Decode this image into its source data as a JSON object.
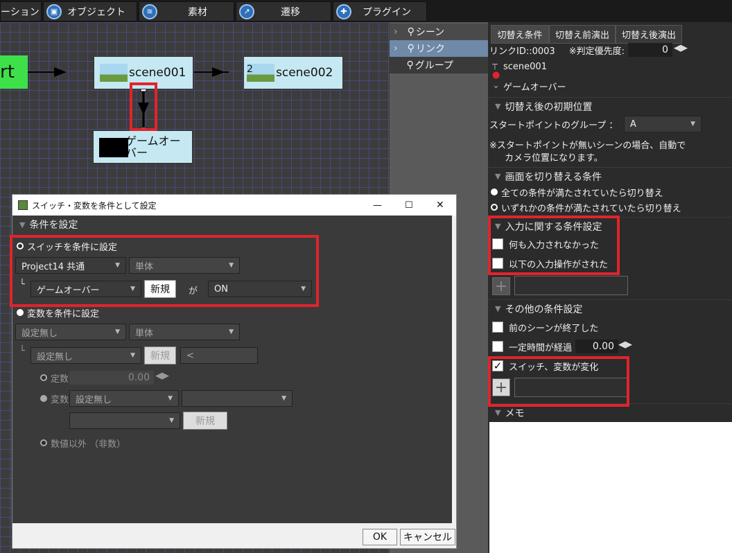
{
  "toolbar": {
    "items": [
      {
        "label": "ーション"
      },
      {
        "label": "オブジェクト"
      },
      {
        "label": "素材"
      },
      {
        "label": "遷移"
      },
      {
        "label": "プラグイン"
      }
    ]
  },
  "canvas": {
    "start_label": "rt",
    "scene1": "scene001",
    "scene2": "scene002",
    "scene3_line1": "ゲームオー",
    "scene3_line2": "バー",
    "scene2_prefix": "2"
  },
  "list": {
    "items": [
      {
        "label": "シーン"
      },
      {
        "label": "リンク"
      },
      {
        "label": "グループ"
      }
    ]
  },
  "props": {
    "tabs": [
      {
        "label": "切替え条件"
      },
      {
        "label": "切替え前演出"
      },
      {
        "label": "切替え後演出"
      }
    ],
    "link_id": "リンクID::0003",
    "priority_label": "※判定優先度:",
    "priority_value": "0",
    "from_scene": "scene001",
    "to_scene": "ゲームオーバー",
    "sec_initial": "切替え後の初期位置",
    "start_group_label": "スタートポイントのグループ ：",
    "start_group_value": "A",
    "note1": "※スタートポイントが無いシーンの場合、自動で",
    "note2": "カメラ位置になります。",
    "sec_conditions": "画面を切り替える条件",
    "radio_all": "全ての条件が満たされていたら切り替え",
    "radio_any": "いずれかの条件が満たされていたら切り替え",
    "sec_input": "入力に関する条件設定",
    "cb_noinput": "何も入力されなかった",
    "cb_input": "以下の入力操作がされた",
    "sec_other": "その他の条件設定",
    "cb_prev": "前のシーンが終了した",
    "cb_time": "一定時間が経過",
    "time_value": "0.00",
    "cb_switch": "スイッチ、変数が変化",
    "check_mark": "✓",
    "sec_memo": "メモ"
  },
  "dialog": {
    "title": "スイッチ・変数を条件として設定",
    "sec": "条件を設定",
    "switch_radio": "スイッチを条件に設定",
    "project": "Project14 共通",
    "single1": "単体",
    "switch_name": "ゲームオーバー",
    "new1": "新規",
    "ga": "が",
    "on": "ON",
    "var_radio": "変数を条件に設定",
    "none1": "設定無し",
    "single2": "単体",
    "none2": "設定無し",
    "new2": "新規",
    "op": "<",
    "const_label": "定数",
    "const_value": "0.00",
    "var_label": "変数",
    "none3": "設定無し",
    "new3": "新規",
    "nonnum": "数値以外 （非数）",
    "ok": "OK",
    "cancel": "キャンセル",
    "minimize": "—",
    "maximize": "☐",
    "close": "✕"
  }
}
